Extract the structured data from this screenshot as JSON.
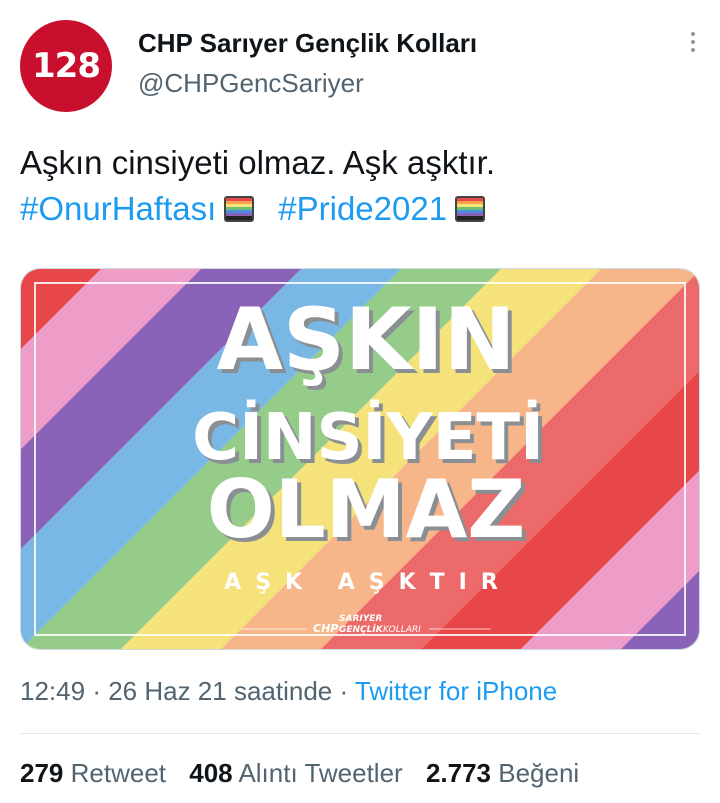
{
  "author": {
    "avatar_text": "128",
    "name": "CHP Sarıyer Gençlik Kolları",
    "handle": "@CHPGencSariyer"
  },
  "tweet": {
    "text_line1": "Aşkın cinsiyeti olmaz. Aşk aşktır.",
    "hashtag1": "#OnurHaftası",
    "hashtag2": "#Pride2021"
  },
  "image": {
    "line1": "AŞKIN",
    "line2": "CİNSİYETİ",
    "line3": "OLMAZ",
    "tagline": "AŞK AŞKTIR",
    "logo_prefix": "CHP",
    "logo_line1": "SARIYER",
    "logo_line2": "GENÇLİK",
    "logo_suffix": "KOLLARI"
  },
  "meta": {
    "time": "12:49",
    "date": "26 Haz 21 saatinde",
    "source": "Twitter for iPhone"
  },
  "stats": {
    "retweets_count": "279",
    "retweets_label": "Retweet",
    "quotes_count": "408",
    "quotes_label": "Alıntı Tweetler",
    "likes_count": "2.773",
    "likes_label": "Beğeni"
  },
  "colors": {
    "brand_red": "#c8102e",
    "link_blue": "#1d9bf0",
    "rainbow": [
      "#e8474a",
      "#ee9cc8",
      "#8a63b8",
      "#79b7e5",
      "#96cc8a",
      "#f6e27a",
      "#f6b68a",
      "#ec6a6a"
    ]
  }
}
